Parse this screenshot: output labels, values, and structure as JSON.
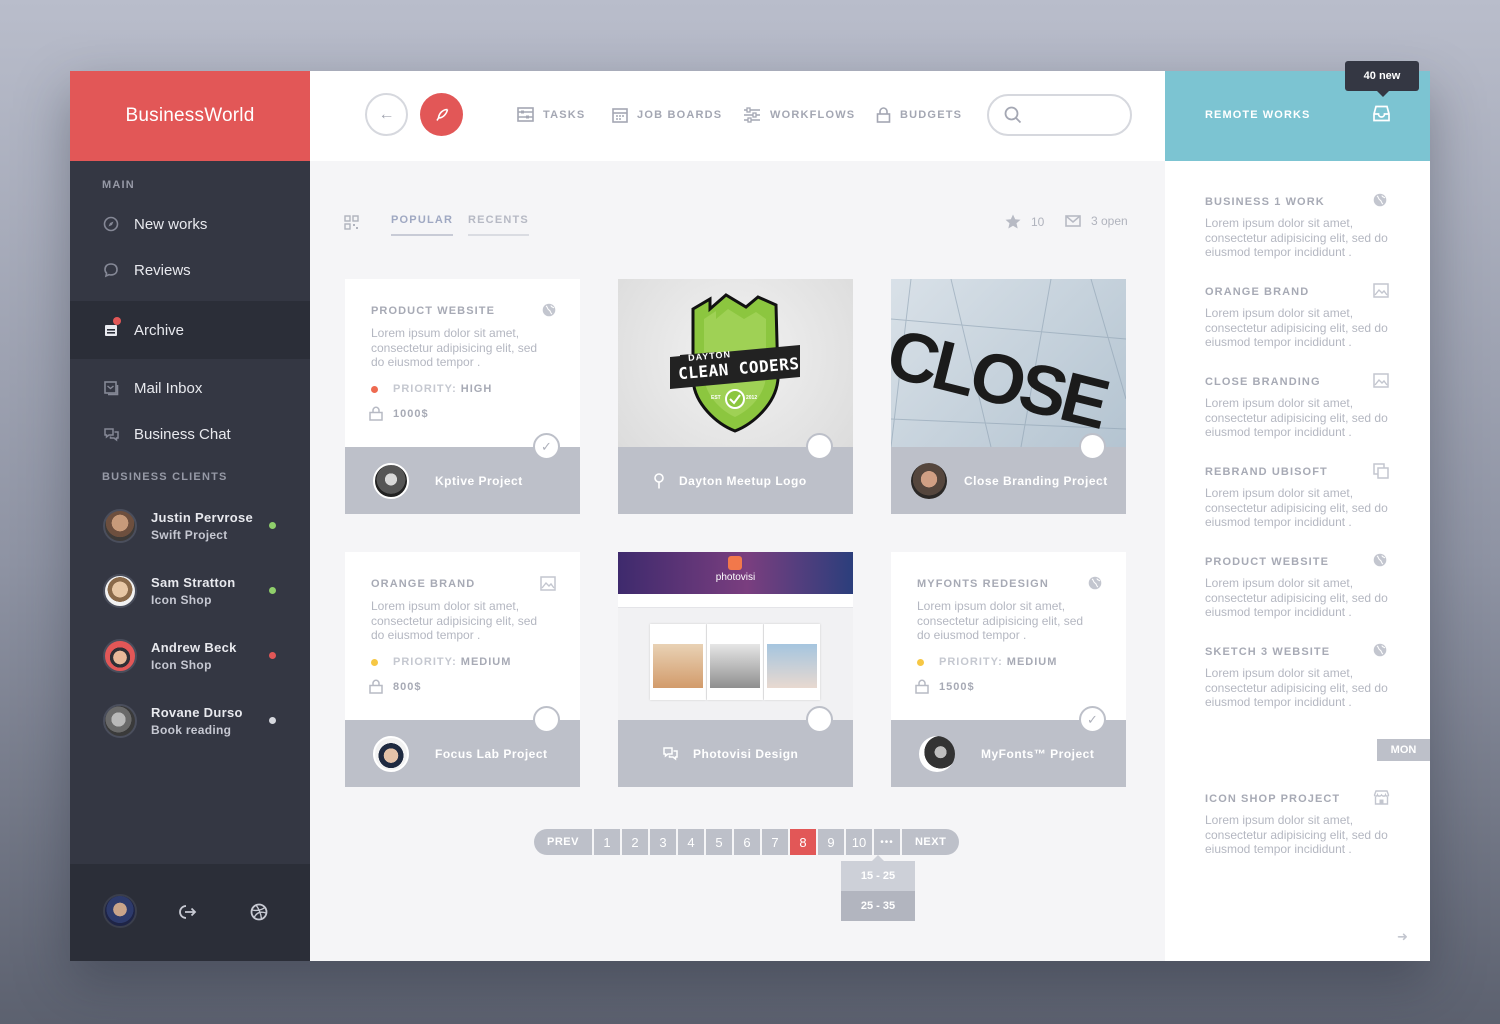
{
  "brand": "BusinessWorld",
  "sidebar": {
    "main_title": "MAIN",
    "items": [
      {
        "label": "New works"
      },
      {
        "label": "Reviews"
      },
      {
        "label": "Archive"
      },
      {
        "label": "Mail Inbox"
      },
      {
        "label": "Business Chat"
      }
    ],
    "clients_title": "BUSINESS CLIENTS",
    "clients": [
      {
        "name": "Justin Pervrose",
        "project": "Swift Project",
        "status_color": "#8fcf6b"
      },
      {
        "name": "Sam Stratton",
        "project": "Icon Shop",
        "status_color": "#8fcf6b"
      },
      {
        "name": "Andrew Beck",
        "project": "Icon Shop",
        "status_color": "#e25757"
      },
      {
        "name": "Rovane Durso",
        "project": "Book reading",
        "status_color": "#d6d8de"
      }
    ]
  },
  "topnav": {
    "tasks": "TASKS",
    "job_boards": "JOB BOARDS",
    "workflows": "WORKFLOWS",
    "budgets": "BUDGETS",
    "search_placeholder": ""
  },
  "subbar": {
    "tab_popular": "POPULAR",
    "tab_recents": "RECENTS",
    "stars": "10",
    "open": "3 open"
  },
  "cards": [
    {
      "title": "PRODUCT WEBSITE",
      "desc": "Lorem ipsum dolor sit amet, consectetur adipisicing elit, sed do eiusmod tempor .",
      "priority_label": "PRIORITY:",
      "priority": "HIGH",
      "priority_color": "#ee6a50",
      "price": "1000$",
      "footer": "Kptive Project",
      "checked": true
    },
    {
      "title": "",
      "footer": "Dayton Meetup Logo",
      "logo": {
        "top": "DAYTON",
        "main": "CLEAN CODERS",
        "est": "EST",
        "year": "2012"
      }
    },
    {
      "title": "",
      "footer": "Close Branding Project",
      "image_text": "CLOSE"
    },
    {
      "title": "ORANGE BRAND",
      "desc": "Lorem ipsum dolor sit amet, consectetur adipisicing elit, sed do eiusmod tempor .",
      "priority_label": "PRIORITY:",
      "priority": "MEDIUM",
      "priority_color": "#f6c744",
      "price": "800$",
      "footer": "Focus Lab Project"
    },
    {
      "title": "",
      "footer": "Photovisi Design",
      "image_text": "photovisi"
    },
    {
      "title": "MYFONTS REDESIGN",
      "desc": "Lorem ipsum dolor sit amet, consectetur adipisicing elit, sed do eiusmod tempor .",
      "priority_label": "PRIORITY:",
      "priority": "MEDIUM",
      "priority_color": "#f6c744",
      "price": "1500$",
      "footer": "MyFonts™ Project",
      "checked": true
    }
  ],
  "pagination": {
    "prev": "PREV",
    "pages": [
      "1",
      "2",
      "3",
      "4",
      "5",
      "6",
      "7",
      "8",
      "9",
      "10"
    ],
    "active": "8",
    "more": "•••",
    "next": "NEXT",
    "dropdown": [
      "15 - 25",
      "25 - 35"
    ]
  },
  "right": {
    "title": "REMOTE WORKS",
    "tooltip": "40 new",
    "items": [
      {
        "title": "BUSINESS 1 WORK",
        "icon": "globe-icon",
        "desc": "Lorem ipsum dolor sit amet, consectetur adipisicing elit, sed do eiusmod tempor incididunt ."
      },
      {
        "title": "ORANGE BRAND",
        "icon": "image-icon",
        "desc": "Lorem ipsum dolor sit amet, consectetur adipisicing elit, sed do eiusmod tempor incididunt ."
      },
      {
        "title": "CLOSE BRANDING",
        "icon": "image-icon",
        "desc": "Lorem ipsum dolor sit amet, consectetur adipisicing elit, sed do eiusmod tempor incididunt ."
      },
      {
        "title": "REBRAND UBISOFT",
        "icon": "copy-icon",
        "desc": "Lorem ipsum dolor sit amet, consectetur adipisicing elit, sed do eiusmod tempor incididunt ."
      },
      {
        "title": "PRODUCT WEBSITE",
        "icon": "globe-icon",
        "desc": "Lorem ipsum dolor sit amet, consectetur adipisicing elit, sed do eiusmod tempor incididunt ."
      },
      {
        "title": "SKETCH 3 WEBSITE",
        "icon": "globe-icon",
        "desc": "Lorem ipsum dolor sit amet, consectetur adipisicing elit, sed do eiusmod tempor incididunt ."
      },
      {
        "title": "ICON SHOP PROJECT",
        "icon": "store-icon",
        "desc": "Lorem ipsum dolor sit amet, consectetur adipisicing elit, sed do eiusmod tempor incididunt ."
      }
    ],
    "day_badge": "MON"
  },
  "colors": {
    "accent": "#e25757",
    "teal": "#7cc4d2",
    "sidebar": "#343743"
  }
}
